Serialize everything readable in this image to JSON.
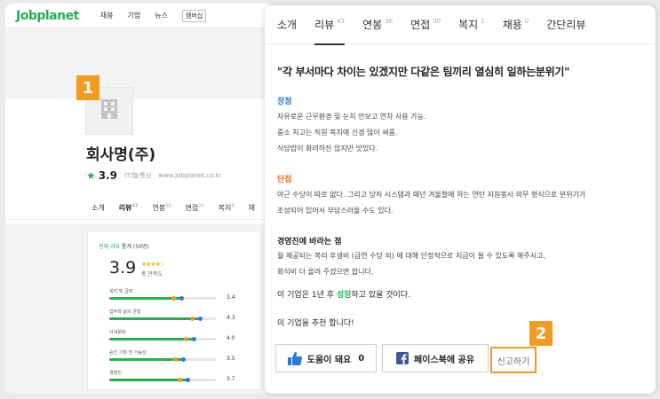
{
  "header": {
    "logo": "Jobplanet",
    "nav": [
      "채용",
      "기업",
      "뉴스"
    ],
    "nav_button": "멤버십"
  },
  "company": {
    "name": "회사명(주)",
    "rating": "3.9",
    "meta": "IT/웹/통신",
    "url": "www.jobplanet.co.kr",
    "tabs": [
      {
        "label": "소개",
        "count": ""
      },
      {
        "label": "리뷰",
        "count": "43"
      },
      {
        "label": "연봉",
        "count": "68"
      },
      {
        "label": "면접",
        "count": "34"
      },
      {
        "label": "복지",
        "count": "8"
      },
      {
        "label": "채",
        "count": ""
      }
    ]
  },
  "stats": {
    "title_green": "전체 리뷰",
    "title_rest": "통계 (59명)",
    "score": "3.9",
    "stars": "★★★★☆",
    "score_label": "총 만족도",
    "bars": [
      {
        "label": "복지 및 급여",
        "value": "3.4",
        "fraction": 0.68
      },
      {
        "label": "업무와 삶의 균형",
        "value": "4.3",
        "fraction": 0.86
      },
      {
        "label": "사내문화",
        "value": "4.0",
        "fraction": 0.8
      },
      {
        "label": "승진 기회 및 가능성",
        "value": "3.5",
        "fraction": 0.7
      },
      {
        "label": "경영진",
        "value": "3.7",
        "fraction": 0.74
      }
    ],
    "colors": {
      "green": "#22b24c",
      "orange": "#f39a21",
      "blue": "#2a7ad6"
    }
  },
  "badges": {
    "one": "1",
    "two": "2"
  },
  "panel": {
    "tabs": [
      {
        "label": "소개",
        "count": ""
      },
      {
        "label": "리뷰",
        "count": "43"
      },
      {
        "label": "연봉",
        "count": "36"
      },
      {
        "label": "면접",
        "count": "30"
      },
      {
        "label": "복지",
        "count": "1"
      },
      {
        "label": "채용",
        "count": "0"
      },
      {
        "label": "간단리뷰",
        "count": ""
      }
    ],
    "review_title": "\"각 부서마다 차이는 있겠지만 다같은 팀끼리 열심히 일하는분위기\"",
    "pros_heading": "장점",
    "pros_lines": [
      "자유로운 근무환경 및 눈치 안보고 연차 사용 가능.",
      "중소 치고는 직원 복지에 신경 많이 써줌.",
      "식당밥이 화려하진 않지만 맛있다."
    ],
    "cons_heading": "단점",
    "cons_lines": [
      "야근 수당이 따로 없다. 그리고 당직 시스템과 매년 겨울철에 하는 연탄 자원봉사 의무 형식으로 분위기가",
      "조성되어 있어서 부담스러울 수도 있다."
    ],
    "mgmt_heading": "경영진에 바라는 점",
    "mgmt_lines": [
      "월 제공되는 복리 후생비 (급연 수당 외) 에 대해 안정적으로 지급이 될 수 있도록 해주시고,",
      "회식비 더 올려 주셨으면 합니다."
    ],
    "future_pre": "이 기업은 1년 후 ",
    "future_highlight": "성장",
    "future_post": "하고 있을 것이다.",
    "recommend": "이 기업을 추천 합니다!",
    "like_label": "도움이 돼요",
    "like_count": "0",
    "fb_label": "페이스북에 공유",
    "report_label": "신고하기"
  }
}
